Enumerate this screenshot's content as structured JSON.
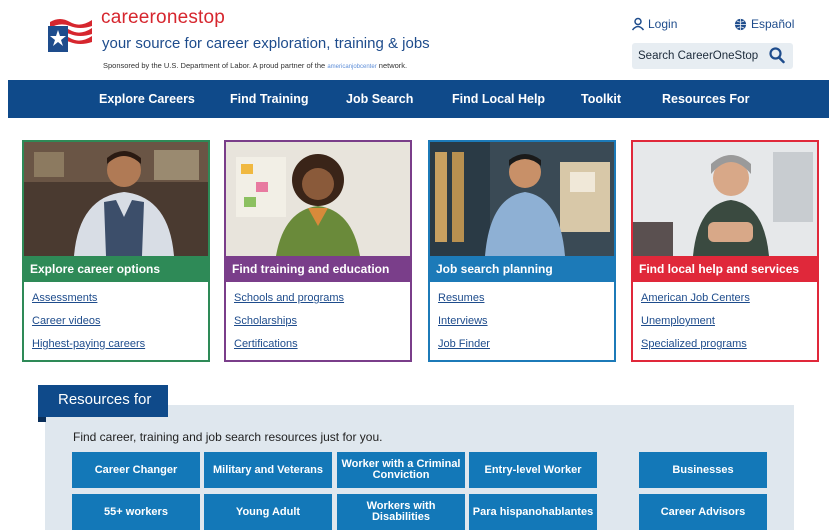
{
  "header": {
    "brand": "careeronestop",
    "tagline": "your source for career exploration, training & jobs",
    "sponsor_text": "Sponsored by the U.S. Department of Labor. A proud partner of the",
    "sponsor_partner": "americanjobcenter",
    "sponsor_suffix": "network.",
    "login_label": "Login",
    "language_label": "Español",
    "search_label": "Search CareerOneStop"
  },
  "nav": {
    "items": [
      "Explore Careers",
      "Find Training",
      "Job Search",
      "Find Local Help",
      "Toolkit",
      "Resources For"
    ]
  },
  "cards": [
    {
      "title": "Explore career options",
      "color": "#2e8a57",
      "links": [
        "Assessments",
        "Career videos",
        "Highest-paying careers"
      ]
    },
    {
      "title": "Find training and education",
      "color": "#7a3e8a",
      "links": [
        "Schools and programs",
        "Scholarships",
        "Certifications"
      ]
    },
    {
      "title": "Job search planning",
      "color": "#1c7ab8",
      "links": [
        "Resumes",
        "Interviews",
        "Job Finder"
      ]
    },
    {
      "title": "Find local help and services",
      "color": "#e0283a",
      "links": [
        "American Job Centers",
        "Unemployment",
        "Specialized programs"
      ]
    }
  ],
  "resources": {
    "title": "Resources for",
    "description": "Find career, training and job search resources just for you.",
    "buttons": [
      "Career Changer",
      "Military and Veterans",
      "Worker with a Criminal Conviction",
      "Entry-level Worker",
      "Businesses",
      "55+ workers",
      "Young Adult",
      "Workers with Disabilities",
      "Para hispanohablantes",
      "Career Advisors"
    ]
  },
  "colors": {
    "nav_bg": "#0f4a8a",
    "brand_red": "#d6262e",
    "brand_blue": "#1e4c8c",
    "button_blue": "#1378b8"
  }
}
